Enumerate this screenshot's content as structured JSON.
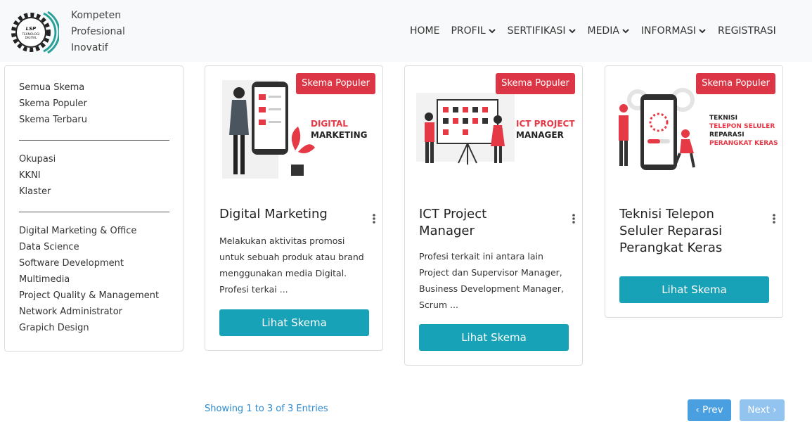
{
  "brand": {
    "logo_text": "LSP TEKNOLOGI DIGITAL",
    "tagline": [
      "Kompeten",
      "Profesional",
      "Inovatif"
    ]
  },
  "nav": {
    "home": "HOME",
    "profil": "PROFIL",
    "sertifikasi": "SERTIFIKASI",
    "media": "MEDIA",
    "informasi": "INFORMASI",
    "registrasi": "REGISTRASI"
  },
  "sidebar": {
    "group1": [
      "Semua Skema",
      "Skema Populer",
      "Skema Terbaru"
    ],
    "group2": [
      "Okupasi",
      "KKNI",
      "Klaster"
    ],
    "group3": [
      "Digital Marketing & Office",
      "Data Science",
      "Software Development",
      "Multimedia",
      "Project Quality & Management",
      "Network Administrator",
      "Grapich Design"
    ]
  },
  "cards": [
    {
      "badge": "Skema Populer",
      "image_caption": [
        "DIGITAL",
        "MARKETING"
      ],
      "title": [
        "Digital Marketing"
      ],
      "text": [
        "Melakukan aktivitas promosi",
        "untuk sebuah produk atau brand",
        "menggunakan media Digital.",
        "Profesi terkai ..."
      ],
      "button": "Lihat Skema"
    },
    {
      "badge": "Skema Populer",
      "image_caption": [
        "ICT PROJECT",
        "MANAGER"
      ],
      "title": [
        "ICT Project",
        "Manager"
      ],
      "text": [
        "Profesi terkait ini antara lain",
        "Project dan Supervisor Manager,",
        "Business Development Manager,",
        "Scrum ..."
      ],
      "button": "Lihat Skema"
    },
    {
      "badge": "Skema Populer",
      "image_caption": [
        "TEKNISI",
        "TELEPON SELULER",
        "REPARASI",
        "PERANGKAT KERAS"
      ],
      "title": [
        "Teknisi Telepon",
        "Seluler Reparasi",
        "Perangkat Keras"
      ],
      "text": [],
      "button": "Lihat Skema"
    }
  ],
  "pagination": {
    "entries": "Showing 1 to 3 of 3 Entries",
    "prev": "Prev",
    "next": "Next"
  },
  "colors": {
    "accent": "#17a2b8",
    "badge": "#dc3545",
    "link": "#2a8ad1",
    "logo_arc": "#2aa198"
  }
}
